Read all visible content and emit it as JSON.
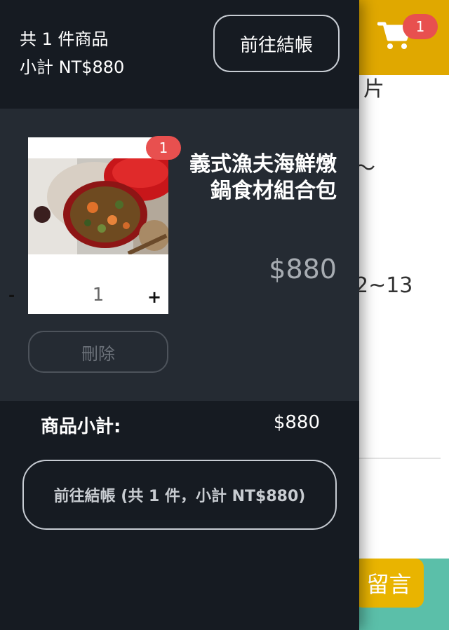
{
  "background": {
    "cart_badge": "1",
    "snippet_1": "片",
    "snippet_2": "～",
    "snippet_3": "2~13",
    "message_button": "留言"
  },
  "drawer": {
    "item_count_text": "共 1 件商品",
    "subtotal_text": "小計 NT$880",
    "checkout_top_label": "前往結帳",
    "item": {
      "badge": "1",
      "title": "義式漁夫海鮮燉鍋食材組合包",
      "price": "$880",
      "qty_minus": "-",
      "qty_value": "1",
      "qty_plus": "+",
      "delete_label": "刪除"
    },
    "summary_label": "商品小計:",
    "summary_value": "$880",
    "checkout_bottom_label": "前往結帳 (共 1 件，小計 NT$880)"
  },
  "colors": {
    "drawer_bg": "#161b22",
    "item_panel_bg": "#252b33",
    "badge": "#e8504f",
    "header_bg": "#e0a800",
    "footer_bg": "#5bbfa9"
  }
}
